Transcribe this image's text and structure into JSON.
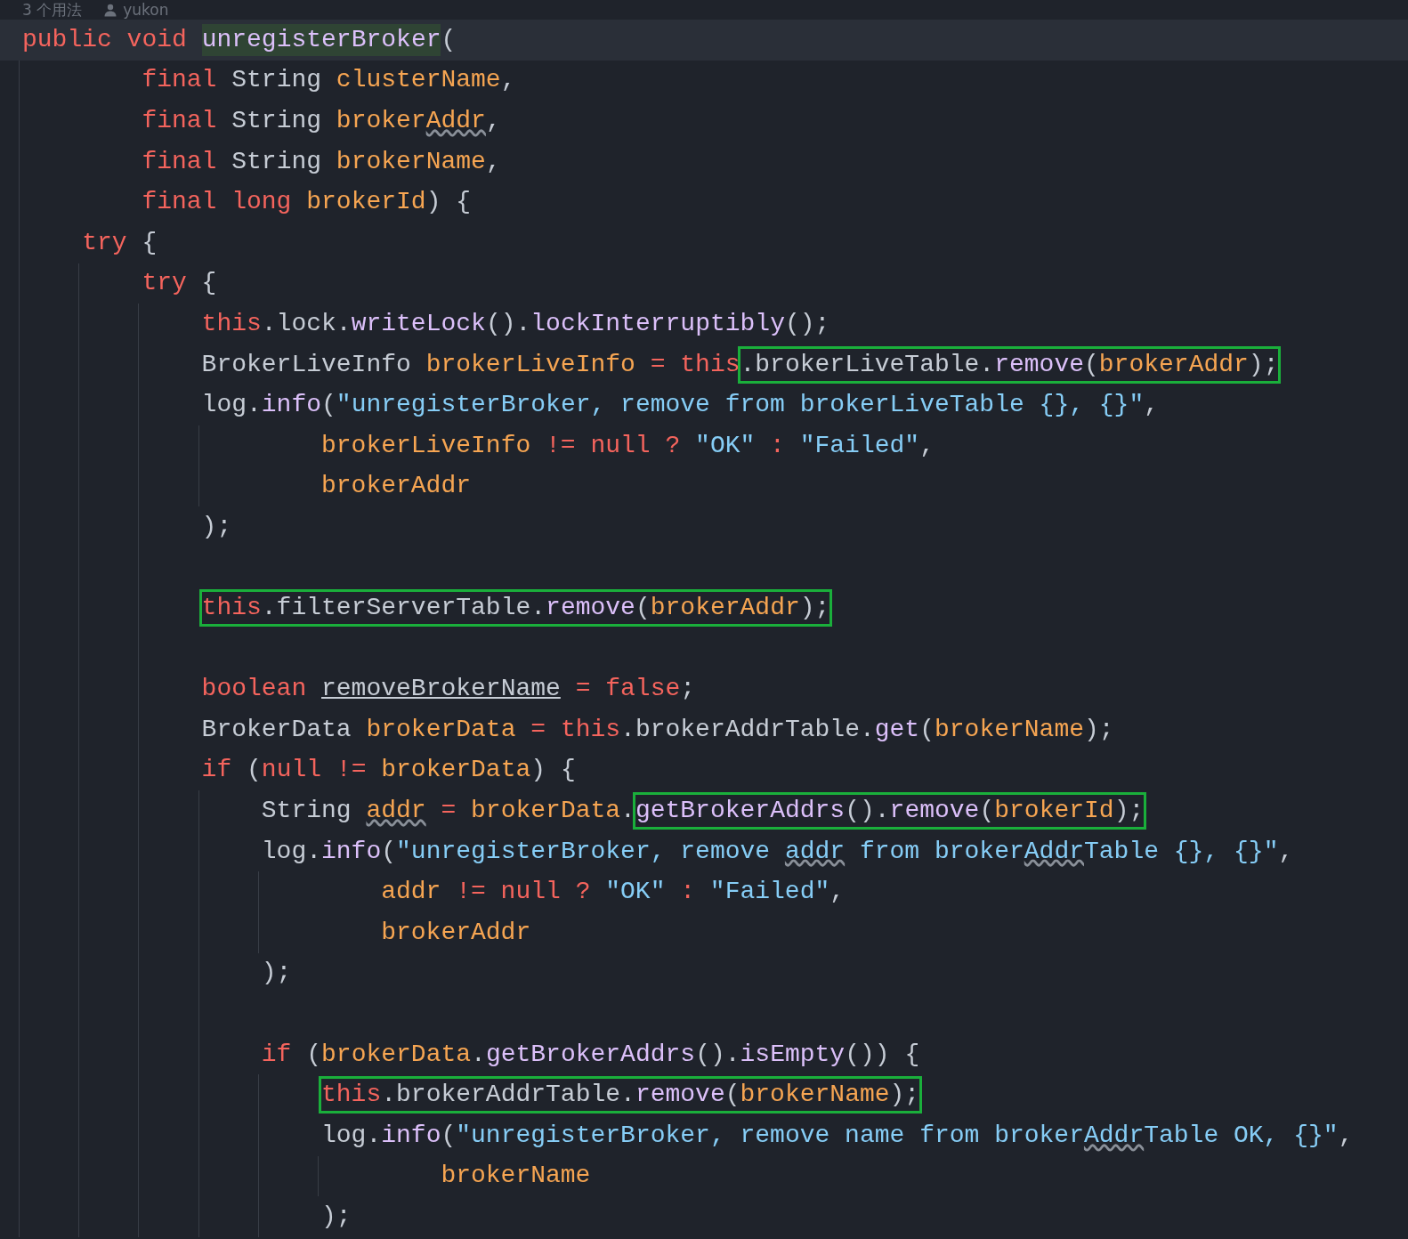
{
  "header": {
    "usages": "3 个用法",
    "author": "yukon"
  },
  "lines": [
    {
      "kind": "line",
      "current": true,
      "tokens": [
        {
          "text": "public void ",
          "kind": "keyword"
        },
        {
          "text": "unregisterBroker",
          "kind": "method",
          "hl": true
        },
        {
          "text": "(",
          "kind": "plain"
        }
      ],
      "params": [
        {
          "kind": "line",
          "tokens": [
            {
              "text": "final ",
              "kind": "keyword"
            },
            {
              "text": "String ",
              "kind": "plain"
            },
            {
              "text": "clusterName",
              "kind": "variable"
            },
            {
              "text": ",",
              "kind": "plain"
            }
          ]
        },
        {
          "kind": "line",
          "tokens": [
            {
              "text": "final ",
              "kind": "keyword"
            },
            {
              "text": "String ",
              "kind": "plain"
            },
            {
              "text": "broker",
              "kind": "variable"
            },
            {
              "text": "Addr",
              "kind": "variable",
              "squiggly": true
            },
            {
              "text": ",",
              "kind": "plain"
            }
          ]
        },
        {
          "kind": "line",
          "tokens": [
            {
              "text": "final ",
              "kind": "keyword"
            },
            {
              "text": "String ",
              "kind": "plain"
            },
            {
              "text": "brokerName",
              "kind": "variable"
            },
            {
              "text": ",",
              "kind": "plain"
            }
          ]
        },
        {
          "kind": "line",
          "tokens": [
            {
              "text": "final long ",
              "kind": "keyword"
            },
            {
              "text": "brokerId",
              "kind": "variable"
            },
            {
              "text": ") {",
              "kind": "plain"
            }
          ]
        }
      ],
      "children": [
        {
          "kind": "line",
          "tokens": [
            {
              "text": "try ",
              "kind": "keyword"
            },
            {
              "text": "{",
              "kind": "plain"
            }
          ],
          "children": [
            {
              "kind": "line",
              "tokens": [
                {
                  "text": "try ",
                  "kind": "keyword"
                },
                {
                  "text": "{",
                  "kind": "plain"
                }
              ],
              "children": [
                {
                  "kind": "line",
                  "tokens": [
                    {
                      "text": "this",
                      "kind": "keyword"
                    },
                    {
                      "text": ".lock.",
                      "kind": "plain"
                    },
                    {
                      "text": "writeLock",
                      "kind": "method"
                    },
                    {
                      "text": "().",
                      "kind": "plain"
                    },
                    {
                      "text": "lockInterruptibly",
                      "kind": "method"
                    },
                    {
                      "text": "();",
                      "kind": "plain"
                    }
                  ]
                },
                {
                  "kind": "line",
                  "tokens": [
                    {
                      "text": "BrokerLiveInfo ",
                      "kind": "plain"
                    },
                    {
                      "text": "brokerLiveInfo ",
                      "kind": "variable"
                    },
                    {
                      "text": "= this",
                      "kind": "keyword"
                    },
                    {
                      "text": ".brokerLiveTable.",
                      "kind": "plain",
                      "box": true
                    },
                    {
                      "text": "remove",
                      "kind": "method",
                      "box": true
                    },
                    {
                      "text": "(",
                      "kind": "plain",
                      "box": true
                    },
                    {
                      "text": "brokerAddr",
                      "kind": "variable",
                      "box": true
                    },
                    {
                      "text": ");",
                      "kind": "plain",
                      "box": true
                    }
                  ]
                },
                {
                  "kind": "line",
                  "tokens": [
                    {
                      "text": "log.",
                      "kind": "plain"
                    },
                    {
                      "text": "info",
                      "kind": "method"
                    },
                    {
                      "text": "(",
                      "kind": "plain"
                    },
                    {
                      "text": "\"unregisterBroker, remove from brokerLiveTable {}, {}\"",
                      "kind": "string"
                    },
                    {
                      "text": ",",
                      "kind": "plain"
                    }
                  ],
                  "args": [
                    {
                      "kind": "line",
                      "tokens": [
                        {
                          "text": "brokerLiveInfo ",
                          "kind": "variable"
                        },
                        {
                          "text": "!= null ? ",
                          "kind": "keyword"
                        },
                        {
                          "text": "\"OK\" ",
                          "kind": "string"
                        },
                        {
                          "text": ": ",
                          "kind": "keyword"
                        },
                        {
                          "text": "\"Failed\"",
                          "kind": "string"
                        },
                        {
                          "text": ",",
                          "kind": "plain"
                        }
                      ]
                    },
                    {
                      "kind": "line",
                      "tokens": [
                        {
                          "text": "brokerAddr",
                          "kind": "variable"
                        }
                      ]
                    }
                  ]
                },
                {
                  "kind": "line",
                  "tokens": [
                    {
                      "text": ");",
                      "kind": "plain"
                    }
                  ]
                },
                {
                  "kind": "blank"
                },
                {
                  "kind": "line",
                  "tokens": [
                    {
                      "text": "this",
                      "kind": "keyword",
                      "box": true
                    },
                    {
                      "text": ".filterServerTable.",
                      "kind": "plain",
                      "box": true
                    },
                    {
                      "text": "remove",
                      "kind": "method",
                      "box": true
                    },
                    {
                      "text": "(",
                      "kind": "plain",
                      "box": true
                    },
                    {
                      "text": "brokerAddr",
                      "kind": "variable",
                      "box": true
                    },
                    {
                      "text": ");",
                      "kind": "plain",
                      "box": true
                    }
                  ]
                },
                {
                  "kind": "blank"
                },
                {
                  "kind": "line",
                  "tokens": [
                    {
                      "text": "boolean ",
                      "kind": "keyword"
                    },
                    {
                      "text": "removeBrokerName",
                      "kind": "plain",
                      "underlined": true
                    },
                    {
                      "text": " = false",
                      "kind": "keyword"
                    },
                    {
                      "text": ";",
                      "kind": "plain"
                    }
                  ]
                },
                {
                  "kind": "line",
                  "tokens": [
                    {
                      "text": "BrokerData ",
                      "kind": "plain"
                    },
                    {
                      "text": "brokerData ",
                      "kind": "variable"
                    },
                    {
                      "text": "= this",
                      "kind": "keyword"
                    },
                    {
                      "text": ".brokerAddrTable.",
                      "kind": "plain"
                    },
                    {
                      "text": "get",
                      "kind": "method"
                    },
                    {
                      "text": "(",
                      "kind": "plain"
                    },
                    {
                      "text": "brokerName",
                      "kind": "variable"
                    },
                    {
                      "text": ");",
                      "kind": "plain"
                    }
                  ]
                },
                {
                  "kind": "line",
                  "tokens": [
                    {
                      "text": "if ",
                      "kind": "keyword"
                    },
                    {
                      "text": "(",
                      "kind": "plain"
                    },
                    {
                      "text": "null != ",
                      "kind": "keyword"
                    },
                    {
                      "text": "brokerData",
                      "kind": "variable"
                    },
                    {
                      "text": ") {",
                      "kind": "plain"
                    }
                  ],
                  "children": [
                    {
                      "kind": "line",
                      "tokens": [
                        {
                          "text": "String ",
                          "kind": "plain"
                        },
                        {
                          "text": "addr",
                          "kind": "variable",
                          "squiggly": true
                        },
                        {
                          "text": " = ",
                          "kind": "keyword"
                        },
                        {
                          "text": "brokerData",
                          "kind": "variable"
                        },
                        {
                          "text": ".",
                          "kind": "plain"
                        },
                        {
                          "text": "getBrokerAddrs",
                          "kind": "method",
                          "box": true
                        },
                        {
                          "text": "().",
                          "kind": "plain",
                          "box": true
                        },
                        {
                          "text": "remove",
                          "kind": "method",
                          "box": true
                        },
                        {
                          "text": "(",
                          "kind": "plain",
                          "box": true
                        },
                        {
                          "text": "brokerId",
                          "kind": "variable",
                          "box": true
                        },
                        {
                          "text": ");",
                          "kind": "plain",
                          "box": true
                        }
                      ]
                    },
                    {
                      "kind": "line",
                      "tokens": [
                        {
                          "text": "log.",
                          "kind": "plain"
                        },
                        {
                          "text": "info",
                          "kind": "method"
                        },
                        {
                          "text": "(",
                          "kind": "plain"
                        },
                        {
                          "text": "\"unregisterBroker, remove ",
                          "kind": "string"
                        },
                        {
                          "text": "addr",
                          "kind": "string",
                          "squiggly": true
                        },
                        {
                          "text": " from broker",
                          "kind": "string"
                        },
                        {
                          "text": "Addr",
                          "kind": "string",
                          "squiggly": true
                        },
                        {
                          "text": "Table {}, {}\"",
                          "kind": "string"
                        },
                        {
                          "text": ",",
                          "kind": "plain"
                        }
                      ],
                      "args": [
                        {
                          "kind": "line",
                          "tokens": [
                            {
                              "text": "addr ",
                              "kind": "variable"
                            },
                            {
                              "text": "!= null ? ",
                              "kind": "keyword"
                            },
                            {
                              "text": "\"OK\" ",
                              "kind": "string"
                            },
                            {
                              "text": ": ",
                              "kind": "keyword"
                            },
                            {
                              "text": "\"Failed\"",
                              "kind": "string"
                            },
                            {
                              "text": ",",
                              "kind": "plain"
                            }
                          ]
                        },
                        {
                          "kind": "line",
                          "tokens": [
                            {
                              "text": "brokerAddr",
                              "kind": "variable"
                            }
                          ]
                        }
                      ]
                    },
                    {
                      "kind": "line",
                      "tokens": [
                        {
                          "text": ");",
                          "kind": "plain"
                        }
                      ]
                    },
                    {
                      "kind": "blank"
                    },
                    {
                      "kind": "line",
                      "tokens": [
                        {
                          "text": "if ",
                          "kind": "keyword"
                        },
                        {
                          "text": "(",
                          "kind": "plain"
                        },
                        {
                          "text": "brokerData",
                          "kind": "variable"
                        },
                        {
                          "text": ".",
                          "kind": "plain"
                        },
                        {
                          "text": "getBrokerAddrs",
                          "kind": "method"
                        },
                        {
                          "text": "().",
                          "kind": "plain"
                        },
                        {
                          "text": "isEmpty",
                          "kind": "method"
                        },
                        {
                          "text": "()) {",
                          "kind": "plain"
                        }
                      ],
                      "children": [
                        {
                          "kind": "line",
                          "tokens": [
                            {
                              "text": "this",
                              "kind": "keyword",
                              "box": true
                            },
                            {
                              "text": ".brokerAddrTable.",
                              "kind": "plain",
                              "box": true
                            },
                            {
                              "text": "remove",
                              "kind": "method",
                              "box": true
                            },
                            {
                              "text": "(",
                              "kind": "plain",
                              "box": true
                            },
                            {
                              "text": "brokerName",
                              "kind": "variable",
                              "box": true
                            },
                            {
                              "text": ");",
                              "kind": "plain",
                              "box": true
                            }
                          ]
                        },
                        {
                          "kind": "line",
                          "tokens": [
                            {
                              "text": "log.",
                              "kind": "plain"
                            },
                            {
                              "text": "info",
                              "kind": "method"
                            },
                            {
                              "text": "(",
                              "kind": "plain"
                            },
                            {
                              "text": "\"unregisterBroker, remove name from broker",
                              "kind": "string"
                            },
                            {
                              "text": "Addr",
                              "kind": "string",
                              "squiggly": true
                            },
                            {
                              "text": "Table OK, {}\"",
                              "kind": "string"
                            },
                            {
                              "text": ",",
                              "kind": "plain"
                            }
                          ],
                          "args": [
                            {
                              "kind": "line",
                              "tokens": [
                                {
                                  "text": "brokerName",
                                  "kind": "variable"
                                }
                              ]
                            }
                          ]
                        },
                        {
                          "kind": "line",
                          "tokens": [
                            {
                              "text": ");",
                              "kind": "plain"
                            }
                          ]
                        }
                      ]
                    }
                  ]
                }
              ]
            }
          ]
        }
      ]
    }
  ]
}
